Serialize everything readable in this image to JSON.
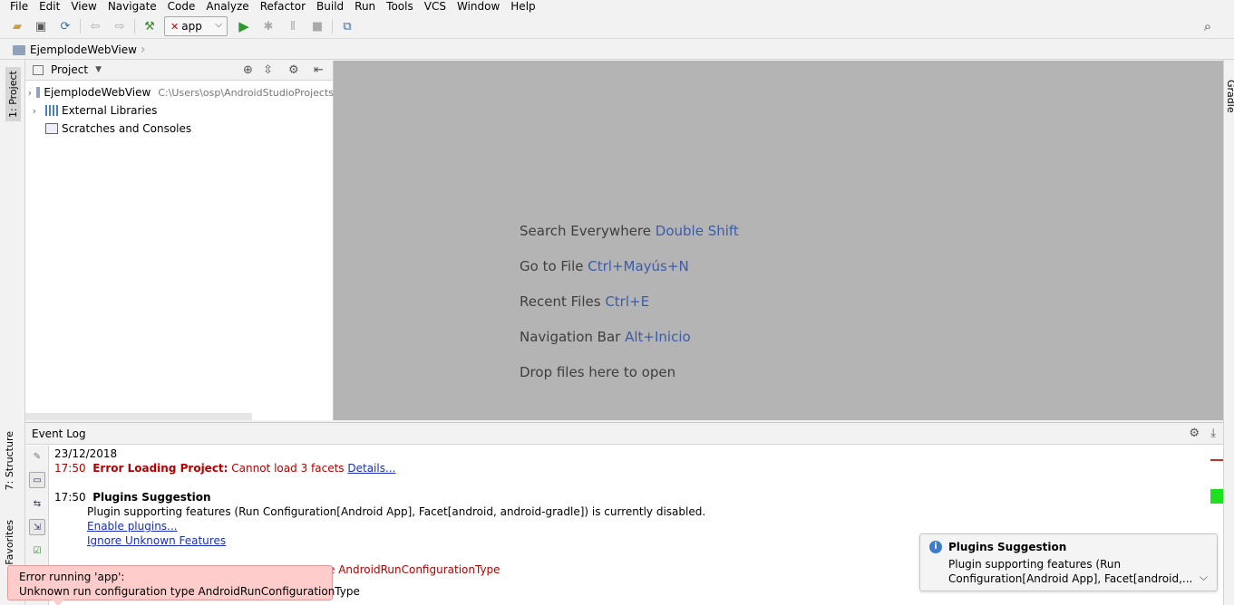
{
  "menu": [
    "File",
    "Edit",
    "View",
    "Navigate",
    "Code",
    "Analyze",
    "Refactor",
    "Build",
    "Run",
    "Tools",
    "VCS",
    "Window",
    "Help"
  ],
  "toolbar": {
    "run_config": "app"
  },
  "breadcrumb": {
    "project": "EjemplodeWebView"
  },
  "left_tabs": {
    "project": "1: Project",
    "structure": "7: Structure",
    "favorites": "Favorites"
  },
  "right_tabs": {
    "gradle": "Gradle"
  },
  "project_panel": {
    "title": "Project",
    "tree": [
      {
        "label": "EjemplodeWebView",
        "path": "C:\\Users\\osp\\AndroidStudioProjects"
      },
      {
        "label": "External Libraries",
        "path": ""
      },
      {
        "label": "Scratches and Consoles",
        "path": ""
      }
    ]
  },
  "editor_hints": [
    {
      "text": "Search Everywhere",
      "keys": "Double Shift"
    },
    {
      "text": "Go to File",
      "keys": "Ctrl+Mayús+N"
    },
    {
      "text": "Recent Files",
      "keys": "Ctrl+E"
    },
    {
      "text": "Navigation Bar",
      "keys": "Alt+Inicio"
    },
    {
      "text": "Drop files here to open",
      "keys": ""
    }
  ],
  "event_log": {
    "title": "Event Log",
    "date": "23/12/2018",
    "entries": [
      {
        "time": "17:50",
        "title": "Error Loading Project:",
        "message": "Cannot load 3 facets",
        "link": "Details..."
      },
      {
        "time": "17:50",
        "title": "Plugins Suggestion",
        "message": "Plugin supporting features (Run Configuration[Android App], Facet[android, android-gradle]) is currently disabled.",
        "links": [
          "Enable plugins...",
          "Ignore Unknown Features"
        ]
      }
    ],
    "partial_error": "e AndroidRunConfigurationType"
  },
  "balloon": {
    "title": "Plugins Suggestion",
    "line1": "Plugin supporting features (Run",
    "line2": "Configuration[Android App], Facet[android,..."
  },
  "error_tooltip": {
    "line1": "Error running 'app':",
    "line2": "Unknown run configuration type AndroidRunConfigurationType"
  },
  "colors": {
    "error_text": "#b30000",
    "link": "#1a2eb8",
    "shortcut": "#3b5ca8",
    "editor_bg": "#b4b4b4",
    "tooltip_bg": "#ffcccc"
  }
}
